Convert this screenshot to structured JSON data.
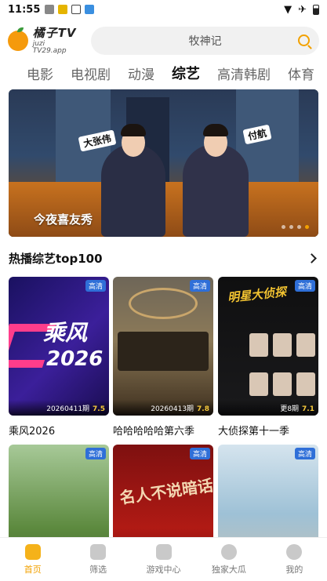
{
  "status_bar": {
    "time": "11:55"
  },
  "header": {
    "app_name": "橘子TV",
    "app_domain": "juzi TV29.app",
    "search_placeholder": "牧神记"
  },
  "tabs": [
    {
      "label": "电影",
      "active": false
    },
    {
      "label": "电视剧",
      "active": false
    },
    {
      "label": "动漫",
      "active": false
    },
    {
      "label": "综艺",
      "active": true
    },
    {
      "label": "高清韩剧",
      "active": false
    },
    {
      "label": "体育",
      "active": false
    }
  ],
  "banner": {
    "title": "今夜喜友秀",
    "name_tag_left": "大张伟",
    "name_tag_right": "付航",
    "slide_count": 4,
    "active_slide": 4
  },
  "section": {
    "title": "热播综艺top100"
  },
  "cards": [
    {
      "title": "乘风2026",
      "badge": "高清",
      "date": "20260411期",
      "score": "7.5",
      "poster_text": "乘风",
      "poster_year": "2026"
    },
    {
      "title": "哈哈哈哈哈第六季",
      "badge": "高清",
      "date": "20260413期",
      "score": "7.8"
    },
    {
      "title": "大侦探第十一季",
      "badge": "高清",
      "date": "更8期",
      "score": "7.1",
      "poster_text": "明星大侦探"
    },
    {
      "title": "",
      "badge": "高清"
    },
    {
      "title": "",
      "badge": "高清",
      "poster_text": "名人不说暗话"
    },
    {
      "title": "",
      "badge": "高清"
    }
  ],
  "bottom_nav": [
    {
      "label": "首页",
      "active": true
    },
    {
      "label": "筛选",
      "active": false
    },
    {
      "label": "游戏中心",
      "active": false
    },
    {
      "label": "独家大瓜",
      "active": false
    },
    {
      "label": "我的",
      "active": false
    }
  ],
  "colors": {
    "accent": "#f2a100",
    "hd_badge": "#2f6fd8"
  }
}
